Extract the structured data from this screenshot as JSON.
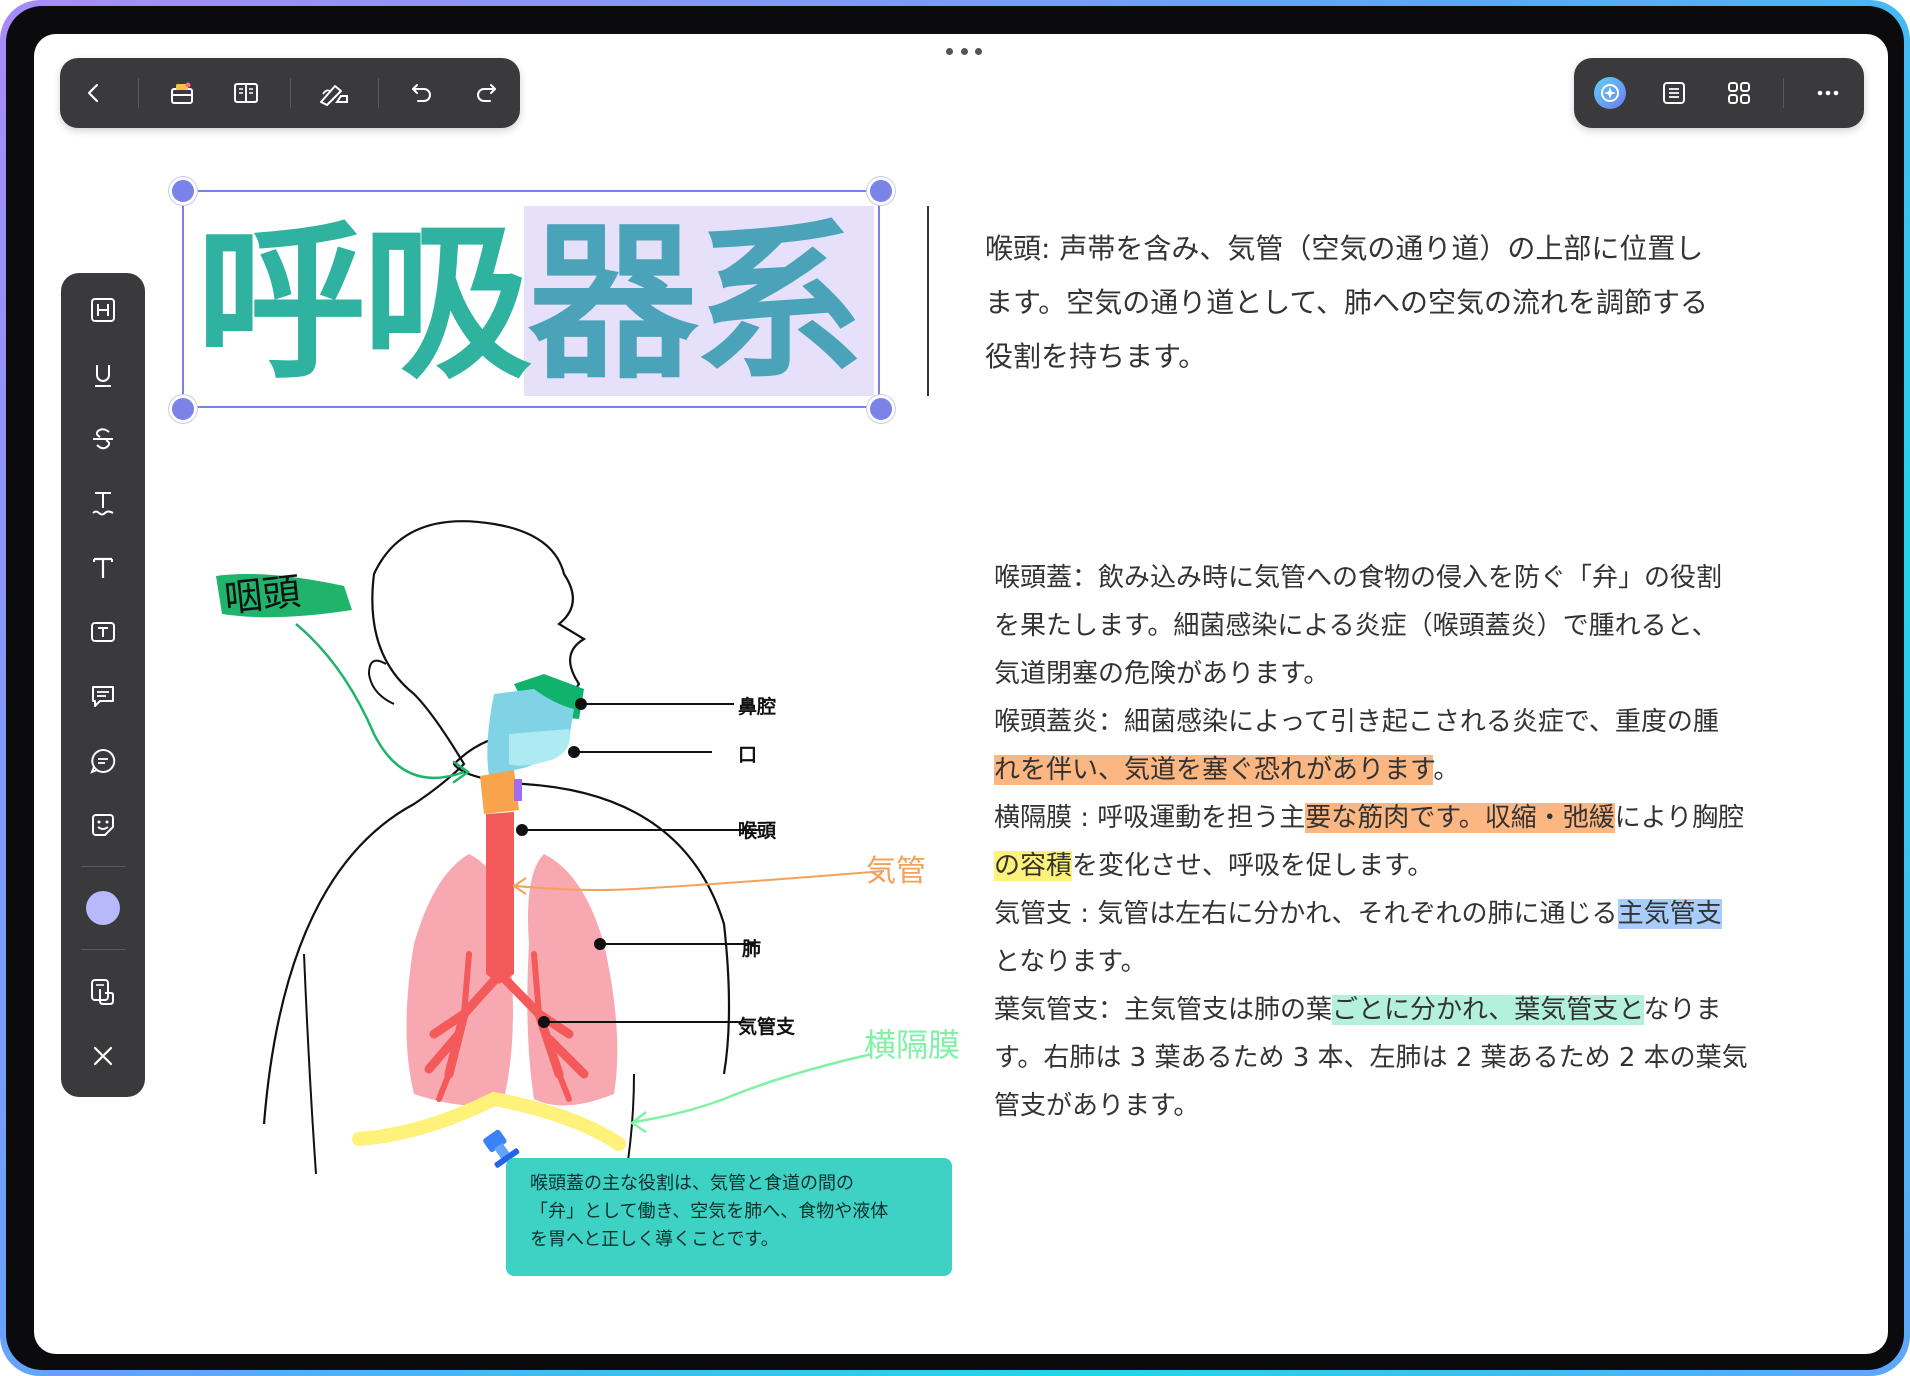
{
  "top_toolbar": {
    "buttons": [
      "back-icon",
      "toolbox-icon",
      "book-icon",
      "pen-eraser-icon",
      "undo-icon",
      "redo-icon"
    ]
  },
  "right_toolbar": {
    "buttons": [
      "ai-assistant-icon",
      "outline-list-icon",
      "grid-view-icon",
      "more-icon"
    ]
  },
  "side_toolbar": {
    "buttons": [
      "heading-icon",
      "underline-icon",
      "strikethrough-icon",
      "text-squiggle-icon",
      "text-icon",
      "textbox-icon",
      "comment-icon",
      "chat-icon",
      "sticker-icon",
      "color-swatch",
      "hand-touch-icon",
      "close-icon"
    ],
    "swatch_color": "#b8b9fb"
  },
  "title": {
    "part1": "呼吸",
    "part2": "器系"
  },
  "paragraph1": {
    "lines": [
      "喉頭: 声帯を含み、気管（空気の通り道）の上部に位置し",
      "ます。空気の通り道として、肺への空気の流れを調節する",
      "役割を持ちます。"
    ]
  },
  "paragraph2": {
    "l1": "喉頭蓋：飲み込み時に気管への食物の侵入を防ぐ「弁」の役割",
    "l2": "を果たします。細菌感染による炎症（喉頭蓋炎）で腫れると、",
    "l3": "気道閉塞の危険があります。",
    "l4": "喉頭蓋炎：細菌感染によって引き起こされる炎症で、重度の腫",
    "l5_hl": "れを伴い、気道を塞ぐ恐れがあります",
    "l5_end": "。",
    "l6_pre": "横隔膜 : 呼吸運動を担う主",
    "l6_hl": "要な筋肉です。収縮・弛緩",
    "l6_post": "により胸腔",
    "l7_hl": "の容積",
    "l7_post": "を変化させ、呼吸を促します。",
    "l8_pre": "気管支 : 気管は左右に分かれ、それぞれの肺に通じる",
    "l8_hl": "主気管支",
    "l9": "となります。",
    "l10_pre": "葉気管支：主気管支は肺の葉",
    "l10_hl": "ごとに分かれ、葉気管支と",
    "l10_post": "なりま",
    "l11": "す。右肺は 3 葉あるため 3 本、左肺は 2 葉あるため 2 本の葉気",
    "l12": "管支があります。"
  },
  "diagram": {
    "labels": {
      "nasal": "鼻腔",
      "mouth": "口",
      "larynx": "喉頭",
      "lung": "肺",
      "bronchus": "気管支"
    },
    "handwritten": {
      "pharynx": "咽頭",
      "trachea": "気管",
      "diaphragm": "横隔膜"
    }
  },
  "note": {
    "lines": [
      "喉頭蓋の主な役割は、気管と食道の間の",
      "「弁」として働き、空気を肺へ、食物や液体",
      "を胃へと正しく導くことです。"
    ]
  },
  "colors": {
    "accent": "#7b82e8",
    "title_teal": "#2fb3a0",
    "title_blue": "#4aa3b8",
    "note_bg": "#3dd2c4"
  }
}
